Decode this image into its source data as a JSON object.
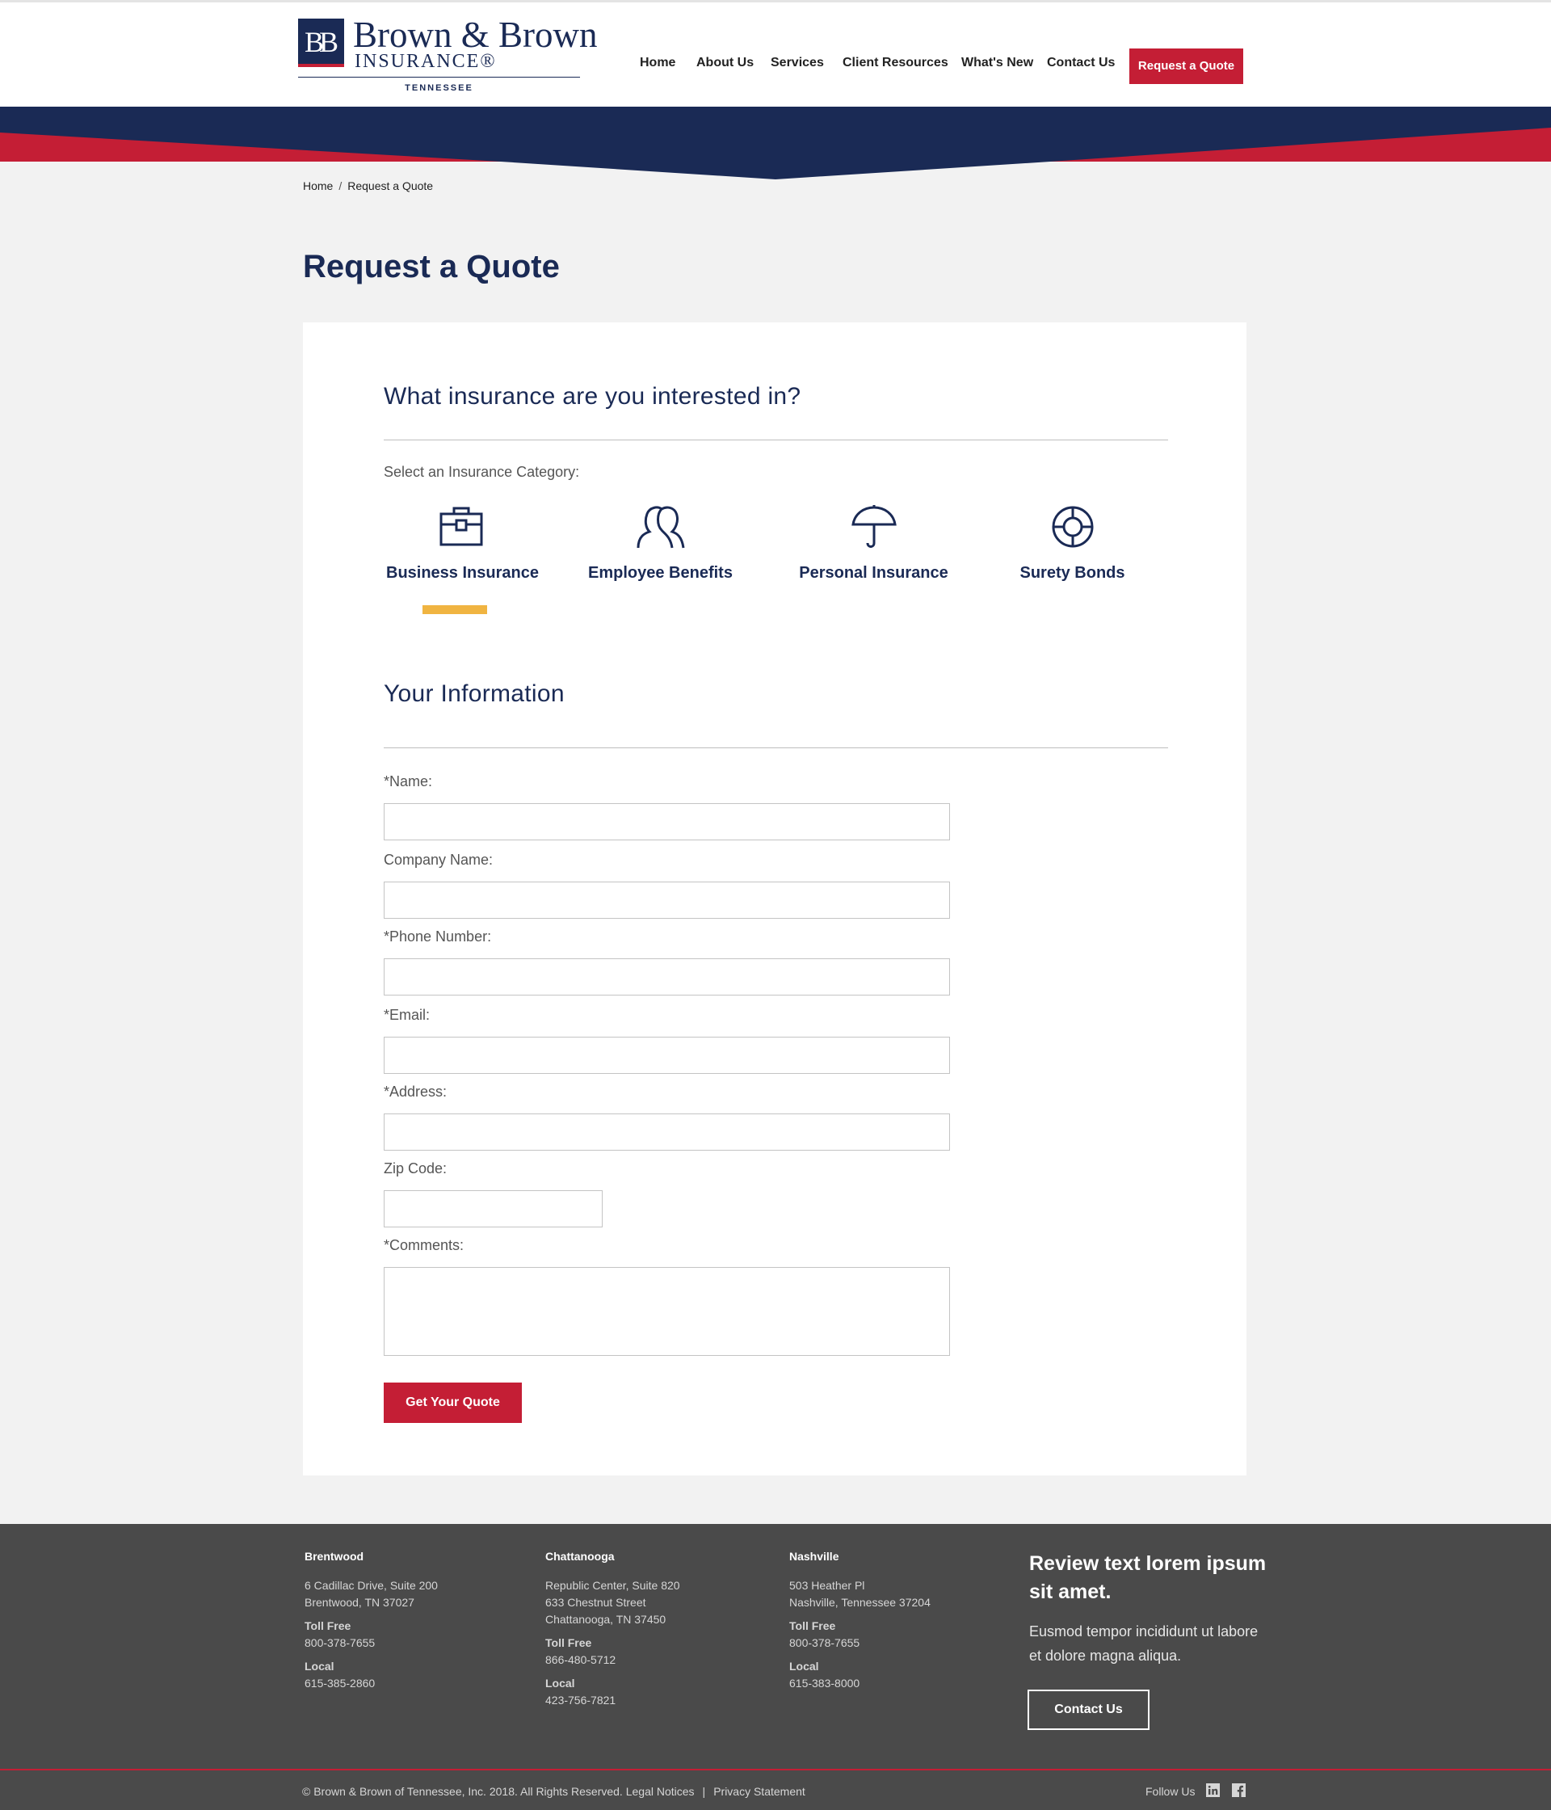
{
  "brand": {
    "monogram": "BB",
    "name_line1": "Brown & Brown",
    "name_line2": "INSURANCE®",
    "name_line3": "TENNESSEE"
  },
  "nav": {
    "items": [
      "Home",
      "About Us",
      "Services",
      "Client Resources",
      "What's New",
      "Contact Us"
    ],
    "cta": "Request a Quote"
  },
  "breadcrumb": {
    "home": "Home",
    "separator": "/",
    "current": "Request a Quote"
  },
  "page": {
    "title": "Request a Quote"
  },
  "insurance": {
    "heading": "What insurance are you interested in?",
    "select_label": "Select an Insurance Category:",
    "categories": [
      {
        "label": "Business Insurance",
        "icon": "briefcase-icon"
      },
      {
        "label": "Employee Benefits",
        "icon": "people-icon"
      },
      {
        "label": "Personal Insurance",
        "icon": "umbrella-icon"
      },
      {
        "label": "Surety Bonds",
        "icon": "lifebuoy-icon"
      }
    ],
    "selected": "Business Insurance"
  },
  "form": {
    "heading": "Your Information",
    "fields": {
      "name": "*Name:",
      "company": "Company Name:",
      "phone": "*Phone Number:",
      "email": "*Email:",
      "address": "*Address:",
      "zip": "Zip Code:",
      "comments": "*Comments:"
    },
    "submit": "Get Your Quote"
  },
  "footer": {
    "offices": [
      {
        "city": "Brentwood",
        "address_lines": [
          "6 Cadillac Drive, Suite 200",
          "Brentwood, TN 37027"
        ],
        "toll_free_label": "Toll Free",
        "toll_free": "800-378-7655",
        "local_label": "Local",
        "local": "615-385-2860"
      },
      {
        "city": "Chattanooga",
        "address_lines": [
          "Republic Center, Suite 820",
          "633 Chestnut Street",
          "Chattanooga, TN 37450"
        ],
        "toll_free_label": "Toll Free",
        "toll_free": "866-480-5712",
        "local_label": "Local",
        "local": "423-756-7821"
      },
      {
        "city": "Nashville",
        "address_lines": [
          "503 Heather Pl",
          "Nashville, Tennessee 37204"
        ],
        "toll_free_label": "Toll Free",
        "toll_free": "800-378-7655",
        "local_label": "Local",
        "local": "615-383-8000"
      }
    ],
    "review_title": "Review text lorem ipsum sit amet.",
    "review_text": "Eusmod tempor incididunt ut labore et dolore magna aliqua.",
    "contact_button": "Contact Us",
    "copyright": "© Brown & Brown of Tennessee, Inc. 2018. All Rights Reserved.",
    "legal_link": "Legal Notices",
    "divider": "|",
    "privacy_link": "Privacy Statement",
    "follow_label": "Follow Us",
    "social": [
      "linkedin-icon",
      "facebook-icon"
    ]
  },
  "colors": {
    "navy": "#1a2a55",
    "red": "#c41e35",
    "accent_yellow": "#f0b441",
    "footer_gray": "#4a4a4a",
    "page_bg": "#f2f2f2"
  }
}
